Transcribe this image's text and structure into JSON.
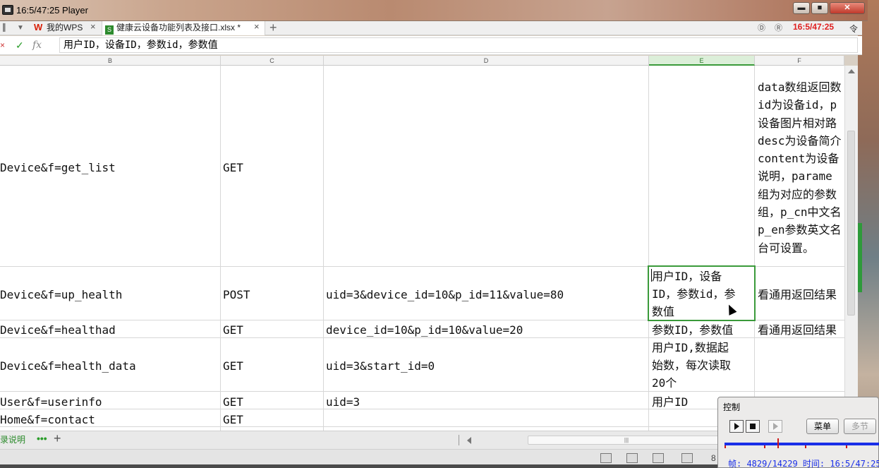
{
  "player": {
    "title": "16:5/47:25 Player",
    "btn_min": "▬",
    "btn_max": "■",
    "btn_close": "✕"
  },
  "tabs": {
    "home_label": "我的WPS",
    "file_label": "健康云设备功能列表及接口.xlsx *",
    "close_glyph": "×",
    "add_glyph": "+",
    "overlay_time": "16:5/47:25",
    "overlay_suffix": "令"
  },
  "formula_bar": {
    "cancel": "×",
    "confirm": "✓",
    "fx": "fx",
    "value": "用户ID，设备ID，参数id，参数值"
  },
  "columns": [
    "B",
    "C",
    "D",
    "E",
    "F"
  ],
  "rows": [
    {
      "b": "Device&f=get_list",
      "c": "GET",
      "d": "",
      "e": "",
      "f": [
        "data数组返回数",
        "id为设备id，p",
        "设备图片相对路",
        "desc为设备简介",
        "content为设备",
        "说明，parame",
        "组为对应的参数",
        "组，p_cn中文名",
        "p_en参数英文名",
        "台可设置。"
      ]
    },
    {
      "b": "Device&f=up_health",
      "c": "POST",
      "d": "uid=3&device_id=10&p_id=11&value=80",
      "e": [
        "用户ID，设备",
        "ID，参数id，参",
        "数值"
      ],
      "f": "看通用返回结果"
    },
    {
      "b": "Device&f=healthad",
      "c": "GET",
      "d": "device_id=10&p_id=10&value=20",
      "e": "参数ID，参数值",
      "f": "看通用返回结果"
    },
    {
      "b": "Device&f=health_data",
      "c": "GET",
      "d": "uid=3&start_id=0",
      "e": [
        "用户ID,数据起",
        "始数，每次读取",
        "20个"
      ],
      "f": ""
    },
    {
      "b": "User&f=userinfo",
      "c": "GET",
      "d": "uid=3",
      "e": "用户ID",
      "f": ""
    },
    {
      "b": "Home&f=contact",
      "c": "GET",
      "d": "",
      "e": "",
      "f": ""
    }
  ],
  "sheetbar": {
    "sheet_tab": "录说明",
    "dots": "•••",
    "add": "+",
    "hscroll_grip": "|||"
  },
  "statusbar": {
    "zoom_hint": "8"
  },
  "control": {
    "title": "控制",
    "menu_label": "菜单",
    "chapter_label": "多节",
    "info": "帧: 4829/14229 时间: 16:5/47:25",
    "progress_fraction": 0.34
  },
  "colors": {
    "selection_green": "#3a9a3a",
    "timeline_blue": "#1a2fe8",
    "overlay_red": "#e02020"
  }
}
